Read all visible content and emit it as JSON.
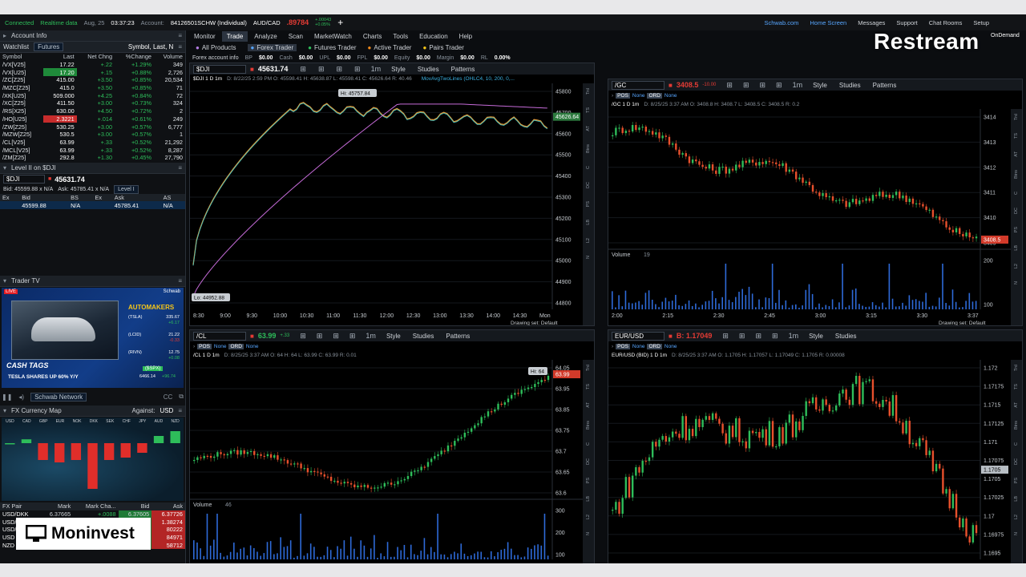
{
  "status": {
    "connected": "Connected",
    "realtime": "Realtime data",
    "date": "Aug, 25",
    "time": "03:37:23",
    "account_label": "Account:",
    "account": "84126501SCHW (Individual)",
    "pair": "AUD/CAD",
    "pair_price": ".89784",
    "pair_c1": "+.00043",
    "pair_c2": "+0.05%"
  },
  "top_links": [
    "Schwab.com",
    "Home Screen",
    "Messages",
    "Support",
    "Chat Rooms",
    "Setup"
  ],
  "ondemand": "OnDemand",
  "restream": "Restream",
  "moninvest": "Moninvest",
  "main_tabs": [
    "Monitor",
    "Trade",
    "Analyze",
    "Scan",
    "MarketWatch",
    "Charts",
    "Tools",
    "Education",
    "Help"
  ],
  "sub_tabs": [
    "All Products",
    "Forex Trader",
    "Futures Trader",
    "Active Trader",
    "Pairs Trader"
  ],
  "forex_info": {
    "label": "Forex account info",
    "items": [
      [
        "BP",
        "$0.00"
      ],
      [
        "Cash",
        "$0.00"
      ],
      [
        "UPL",
        "$0.00"
      ],
      [
        "FPL",
        "$0.00"
      ],
      [
        "Equity",
        "$0.00"
      ],
      [
        "Margin",
        "$0.00"
      ],
      [
        "RL",
        "0.00%"
      ]
    ]
  },
  "left": {
    "account_info": "Account Info",
    "watchlist": {
      "title": "Watchlist",
      "list": "Futures",
      "search": "Symbol, Last, N",
      "cols": [
        "Symbol",
        "Last",
        "Net Chng",
        "%Change",
        "Volume"
      ],
      "rows": [
        [
          "/VX[V25]",
          "17.22",
          "+.22",
          "+1.29%",
          "349"
        ],
        [
          "/VX[U25]",
          "17.20",
          "+.15",
          "+0.88%",
          "2,726"
        ],
        [
          "/ZC[Z25]",
          "415.00",
          "+3.50",
          "+0.85%",
          "20,534"
        ],
        [
          "/MZC[Z25]",
          "415.0",
          "+3.50",
          "+0.85%",
          "71"
        ],
        [
          "/XK[U25]",
          "509.000",
          "+4.25",
          "+0.84%",
          "72"
        ],
        [
          "/XC[Z25]",
          "411.50",
          "+3.00",
          "+0.73%",
          "324"
        ],
        [
          "/RS[X25]",
          "630.00",
          "+4.50",
          "+0.72%",
          "2"
        ],
        [
          "/HO[U25]",
          "2.3221",
          "+.014",
          "+0.61%",
          "249"
        ],
        [
          "/ZW[Z25]",
          "530.25",
          "+3.00",
          "+0.57%",
          "6,777"
        ],
        [
          "/MZW[Z25]",
          "530.5",
          "+3.00",
          "+0.57%",
          "1"
        ],
        [
          "/CL[V25]",
          "63.99",
          "+.33",
          "+0.52%",
          "21,292"
        ],
        [
          "/MCL[V25]",
          "63.99",
          "+.33",
          "+0.52%",
          "8,287"
        ],
        [
          "/ZM[Z25]",
          "292.8",
          "+1.30",
          "+0.45%",
          "27,790"
        ]
      ]
    },
    "level2": {
      "title": "Level II on $DJI",
      "symbol": "$DJI",
      "price": "45631.74",
      "bid_line": "Bid: 45599.88 x N/A",
      "ask_line": "Ask: 45785.41 x N/A",
      "mode": "Level I",
      "cols": [
        "Ex",
        "Bid",
        "BS",
        "Ex",
        "Ask",
        "AS"
      ],
      "row": [
        "",
        "45599.88",
        "N/A",
        "",
        "45785.41",
        "N/A"
      ]
    },
    "trader_tv": {
      "title": "Trader TV",
      "badge": "LIVE",
      "brand": "Schwab",
      "heading": "AUTOMAKERS",
      "quotes": [
        [
          "(TSLA)",
          "335.67",
          "+6.17"
        ],
        [
          "(LCID)",
          "21.22",
          "-0.33"
        ],
        [
          "(RIVN)",
          "12.75",
          "+0.08"
        ]
      ],
      "spx": "($SPX)",
      "spx_val": "6466.14",
      "spx_chg": "+96.74",
      "cashtags": "CASH TAGS",
      "headline": "TESLA SHARES UP 60% Y/Y",
      "network": "Schwab Network"
    },
    "fx_map": {
      "title": "FX Currency Map",
      "against_label": "Against:",
      "against": "USD",
      "currencies": [
        "USD",
        "CAD",
        "GBP",
        "EUR",
        "NOK",
        "DKK",
        "SEK",
        "CHF",
        "JPY",
        "AUD",
        "NZD"
      ],
      "bars": [
        0,
        0.08,
        -0.35,
        -0.4,
        -0.35,
        -0.95,
        -0.35,
        -0.3,
        -0.2,
        0.15,
        0.25
      ],
      "cols": [
        "FX Pair",
        "Mark",
        "Mark Cha...",
        "Bid",
        "Ask"
      ],
      "rows": [
        [
          "USD/DKK",
          "6.37665",
          "+.0088",
          "6.37605",
          "6.37726"
        ],
        [
          "USD/",
          "",
          "",
          "",
          "1.38274"
        ],
        [
          "USD/",
          "",
          "",
          "",
          "80222"
        ],
        [
          "USD",
          "",
          "",
          "",
          "84971"
        ],
        [
          "NZD",
          "",
          "",
          "",
          "58712"
        ]
      ]
    }
  },
  "charts": [
    {
      "id": "dji",
      "symbol": "$DJI",
      "price": "45631.74",
      "title": "$DJI 1 D 1m",
      "ohlc": "D: 8/22/25 2:59 PM   O: 45598.41   H: 45638.87   L: 45598.41   C: 45626.64   R: 40.46",
      "study": "MovAvgTwoLines (OHLC4, 10, 200, 0,...",
      "hi": "Hi: 45757.84",
      "lo": "Lo: 44952.88",
      "last_tag": "45626.64",
      "yticks": [
        "45800",
        "45700",
        "45600",
        "45500",
        "45400",
        "45300",
        "45200",
        "45100",
        "45000",
        "44900",
        "44800"
      ],
      "xticks": [
        "8:30",
        "9:00",
        "9:30",
        "10:00",
        "10:30",
        "11:00",
        "11:30",
        "12:00",
        "12:30",
        "13:00",
        "13:30",
        "14:00",
        "14:30",
        "Mon"
      ]
    },
    {
      "id": "gc",
      "symbol": "/GC",
      "price": "3408.5",
      "price_chg": "-10.00",
      "title": "/GC 1 D 1m",
      "ohlc": "D: 8/25/25 3:37 AM   O: 3408.8   H: 3408.7   L: 3408.5   C: 3408.5   R: 0.2",
      "volume_label": "Volume",
      "volume_val": "19",
      "last_tag": "3408.5",
      "yticks": [
        "3414",
        "3413",
        "3412",
        "3411",
        "3410",
        "3409"
      ],
      "vticks": [
        "200",
        "100"
      ],
      "xticks": [
        "2:00",
        "2:15",
        "2:30",
        "2:45",
        "3:00",
        "3:15",
        "3:30",
        "3:37"
      ]
    },
    {
      "id": "cl",
      "symbol": "/CL",
      "price": "63.99",
      "price_chg": "+.33",
      "title": "/CL 1 D 1m",
      "ohlc": "D: 8/25/25 3:37 AM   O: 64   H: 64   L: 63.99   C: 63.99   R: 0.01",
      "hi": "Hi: 64",
      "volume_label": "Volume",
      "volume_val": "46",
      "last_tag": "63.99",
      "yticks": [
        "64.05",
        "63.95",
        "63.85",
        "63.75",
        "63.7",
        "63.65",
        "63.6"
      ],
      "vticks": [
        "300",
        "200",
        "100"
      ],
      "xticks": [
        "1:15",
        "1:30",
        "1:45",
        "2:00",
        "2:15",
        "2:30",
        "2:45",
        "3:00",
        "3:15",
        "3:30"
      ]
    },
    {
      "id": "eur",
      "symbol": "EUR/USD",
      "price": "B: 1.17049",
      "title": "EUR/USD (BID) 1 D 1m",
      "ohlc": "D: 8/25/25 3:37 AM   O: 1.1705   H: 1.17057   L: 1.17049   C: 1.1705   R: 0.00008",
      "last_tag": "1.1705",
      "yticks": [
        "1.172",
        "1.17175",
        "1.1715",
        "1.17125",
        "1.171",
        "1.17075",
        "1.1705",
        "1.17025",
        "1.17",
        "1.16975",
        "1.1695"
      ],
      "xticks": [
        "1:00",
        "1:15",
        "1:30",
        "1:45",
        "2:00",
        "2:15",
        "2:30",
        "2:45",
        "3:00",
        "3:15",
        "3:30"
      ]
    }
  ],
  "chart_ui": {
    "style": "Style",
    "studies": "Studies",
    "patterns": "Patterns",
    "drawing_set": "Drawing set: Default",
    "agg": "1m",
    "pos": "POS",
    "ord": "ORD",
    "none": "None"
  },
  "side_tabs": [
    "Trd",
    "TS",
    "AT",
    "Btns",
    "C",
    "DC",
    "PS",
    "LB",
    "L2",
    "N"
  ]
}
